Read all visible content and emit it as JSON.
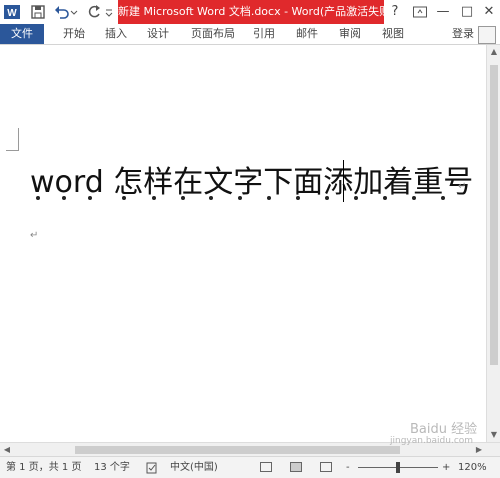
{
  "window": {
    "title": "新建 Microsoft Word 文档.docx - Word(产品激活失败)",
    "help": "?",
    "minimize": "—",
    "restore": "□",
    "close": "✕"
  },
  "ribbon": {
    "tabs": [
      "文件",
      "开始",
      "插入",
      "设计",
      "页面布局",
      "引用",
      "邮件",
      "审阅",
      "视图"
    ],
    "login": "登录"
  },
  "document": {
    "text": "word 怎样在文字下面添加着重号",
    "emphasis_dot_count": 15,
    "paragraph_mark": "↵"
  },
  "status": {
    "page": "第 1 页，共 1 页",
    "word_count": "13 个字",
    "language": "中文(中国)",
    "zoom_minus": "-",
    "zoom_plus": "+",
    "zoom": "120%",
    "zoom_level": 0.5
  },
  "watermark": {
    "text": "Baidu 经验",
    "url": "jingyan.baidu.com"
  },
  "colors": {
    "title_bg": "#e0292c",
    "file_tab_bg": "#2b579a"
  }
}
